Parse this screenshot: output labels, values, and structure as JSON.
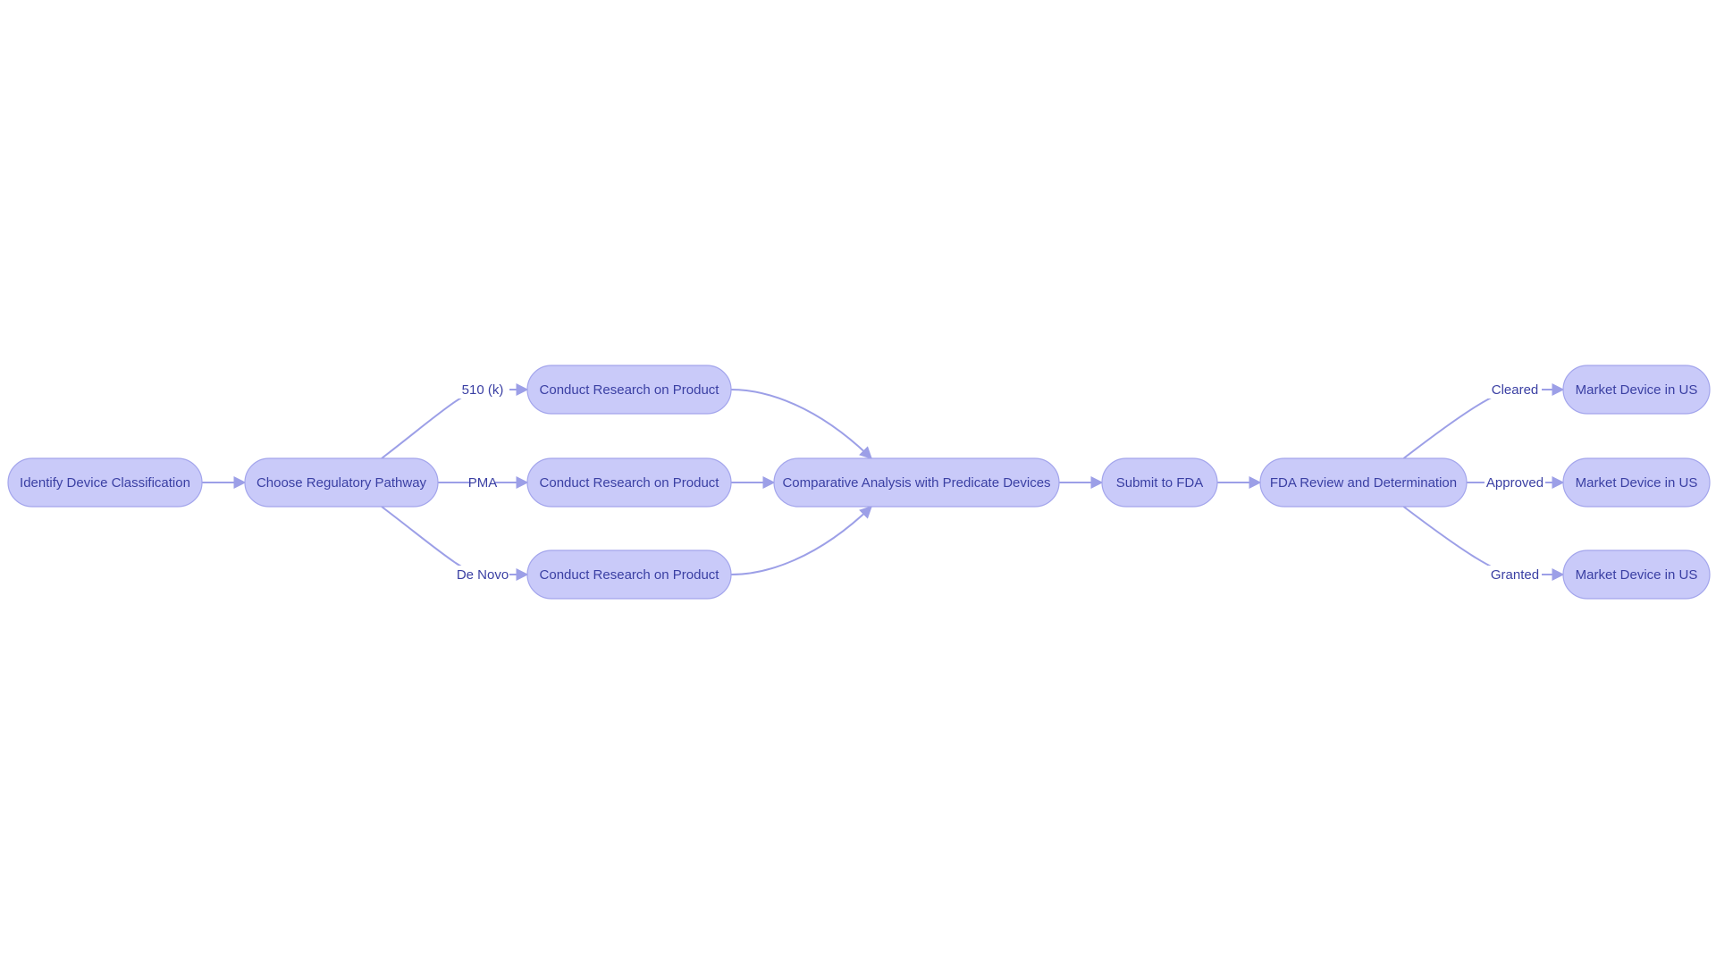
{
  "diagram": {
    "type": "flowchart",
    "direction": "left-to-right",
    "colors": {
      "node_fill": "#c9caf9",
      "node_stroke": "#a3a5ec",
      "edge": "#9c9fe7",
      "text": "#3a3fa3"
    },
    "nodes": [
      {
        "id": "A",
        "label": "Identify Device Classification"
      },
      {
        "id": "B",
        "label": "Choose Regulatory Pathway"
      },
      {
        "id": "C1",
        "label": "Conduct Research on Product"
      },
      {
        "id": "C2",
        "label": "Conduct Research on Product"
      },
      {
        "id": "C3",
        "label": "Conduct Research on Product"
      },
      {
        "id": "D",
        "label": "Comparative Analysis with Predicate Devices"
      },
      {
        "id": "E",
        "label": "Submit to FDA"
      },
      {
        "id": "F",
        "label": "FDA Review and Determination"
      },
      {
        "id": "G1",
        "label": "Market Device in US"
      },
      {
        "id": "G2",
        "label": "Market Device in US"
      },
      {
        "id": "G3",
        "label": "Market Device in US"
      }
    ],
    "edges": [
      {
        "from": "A",
        "to": "B",
        "label": ""
      },
      {
        "from": "B",
        "to": "C1",
        "label": "510 (k)"
      },
      {
        "from": "B",
        "to": "C2",
        "label": "PMA"
      },
      {
        "from": "B",
        "to": "C3",
        "label": "De Novo"
      },
      {
        "from": "C1",
        "to": "D",
        "label": ""
      },
      {
        "from": "C2",
        "to": "D",
        "label": ""
      },
      {
        "from": "C3",
        "to": "D",
        "label": ""
      },
      {
        "from": "D",
        "to": "E",
        "label": ""
      },
      {
        "from": "E",
        "to": "F",
        "label": ""
      },
      {
        "from": "F",
        "to": "G1",
        "label": "Cleared"
      },
      {
        "from": "F",
        "to": "G2",
        "label": "Approved"
      },
      {
        "from": "F",
        "to": "G3",
        "label": "Granted"
      }
    ]
  }
}
